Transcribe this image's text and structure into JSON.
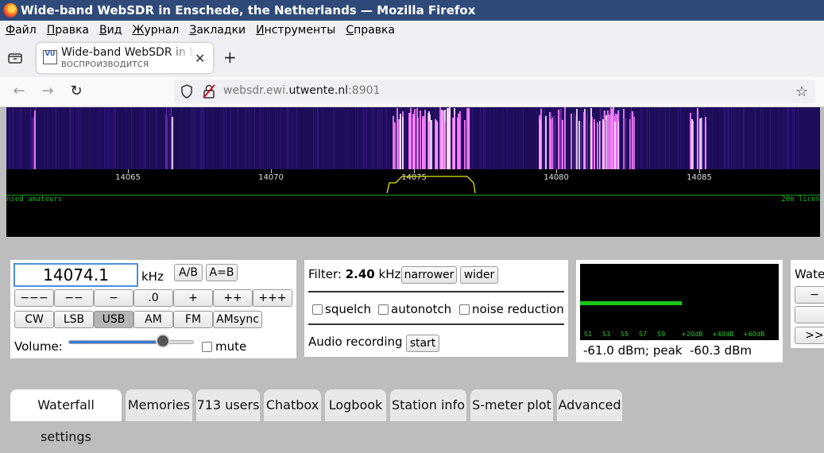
{
  "window": {
    "title": "Wide-band WebSDR in Enschede, the Netherlands — Mozilla Firefox"
  },
  "menu": [
    "Файл",
    "Правка",
    "Вид",
    "Журнал",
    "Закладки",
    "Инструменты",
    "Справка"
  ],
  "tab": {
    "title": "Wide-band WebSDR in Enschede, the Netherlands",
    "subtitle": "ВОСПРОИЗВОДИТСЯ",
    "favicon_text": "VU"
  },
  "url": {
    "prefix": "websdr.ewi.",
    "domain": "utwente.nl",
    "suffix": ":8901"
  },
  "waterfall": {
    "ticks": [
      "14065",
      "14070",
      "14075",
      "14080",
      "14085"
    ],
    "band_left": "nsed amateurs",
    "band_right": "20m licen"
  },
  "frequency": {
    "value": "14074.1",
    "unit": "kHz",
    "ab_label": "A/B",
    "aeqb_label": "A=B",
    "step_buttons": [
      "−−−",
      "−−",
      "−",
      ".0",
      "+",
      "++",
      "+++"
    ],
    "modes": [
      "CW",
      "LSB",
      "USB",
      "AM",
      "FM",
      "AMsync"
    ],
    "selected_mode": "USB",
    "volume_label": "Volume:",
    "volume_level": 0.75,
    "mute_label": "mute"
  },
  "filter": {
    "label": "Filter:",
    "value": "2.40",
    "unit": "kHz",
    "narrower": "narrower",
    "wider": "wider",
    "squelch": "squelch",
    "autonotch": "autonotch",
    "noise_reduction": "noise reduction",
    "recording_label": "Audio recording",
    "start": "start"
  },
  "smeter": {
    "labels": [
      "S1",
      "S3",
      "S5",
      "S7",
      "S9",
      "+20dB",
      "+40dB",
      "+60dB"
    ],
    "level": 0.51,
    "reading": "-61.0 dBm; peak  -60.3 dBm"
  },
  "waterfall_settings_panel": {
    "title": "Waterfall",
    "btn1": "−",
    "btn3": ">>"
  },
  "bottom_tabs": [
    "Waterfall settings",
    "Memories",
    "713 users",
    "Chatbox",
    "Logbook",
    "Station info",
    "S-meter plot",
    "Advanced"
  ],
  "colors": {
    "titlebar": "#2f4a78",
    "waterfall_bg": "#1e0e5a",
    "signal": "#ff80ff",
    "band_green": "#1fb41f"
  }
}
